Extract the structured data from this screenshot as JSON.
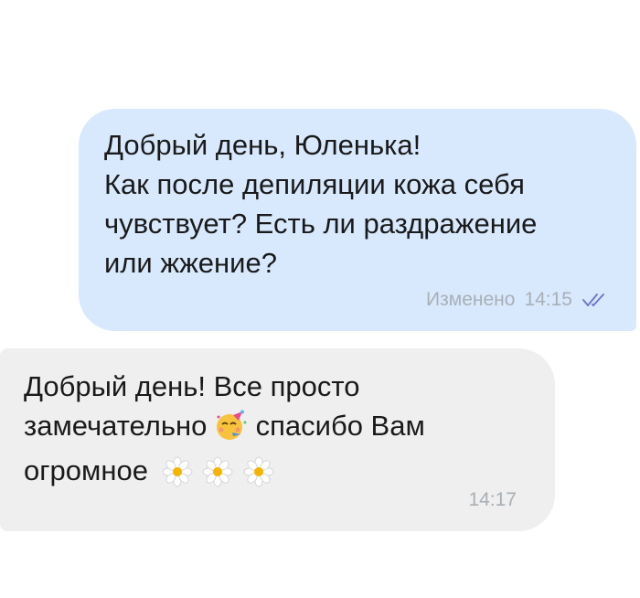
{
  "messages": [
    {
      "direction": "outgoing",
      "lines": [
        "Добрый день, Юленька!",
        "Как после депиляции кожа себя",
        "чувствует? Есть ли раздражение",
        "или жжение?"
      ],
      "edited_label": "Изменено",
      "time": "14:15",
      "status_icon": "double-check-icon"
    },
    {
      "direction": "incoming",
      "line1": "Добрый день! Все просто",
      "line2_before": "замечательно",
      "line2_emoji": "partying-face-icon",
      "line2_after": "спасибо Вам",
      "line3": "огромное",
      "line3_emojis": [
        "daisy-icon",
        "daisy-icon",
        "daisy-icon"
      ],
      "time": "14:17"
    }
  ],
  "colors": {
    "outgoing_bubble": "#d8e9fd",
    "incoming_bubble": "#efefef",
    "meta_text": "#a9afb6",
    "check": "#6f78c9"
  }
}
